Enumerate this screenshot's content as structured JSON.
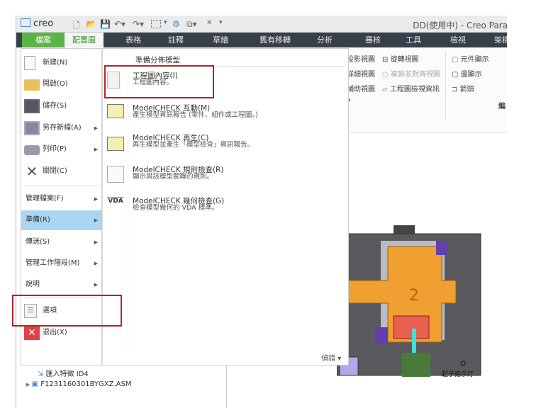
{
  "titlebar": {
    "app_logo": "creo",
    "title": "DD(使用中) - Creo Para"
  },
  "tabs": [
    {
      "label": "檔案"
    },
    {
      "label": "配置圖"
    },
    {
      "label": "表格"
    },
    {
      "label": "註釋"
    },
    {
      "label": "草繪"
    },
    {
      "label": "舊有移轉"
    },
    {
      "label": "分析"
    },
    {
      "label": "審核"
    },
    {
      "label": "工具"
    },
    {
      "label": "檢視"
    },
    {
      "label": "架構"
    }
  ],
  "ribbon": {
    "col1": [
      "投影視圖",
      "詳細視圖",
      "輔助視圖"
    ],
    "col2": [
      "旋轉視圖",
      "複製並對齊視圖",
      "工程圖檢視資訊"
    ],
    "col3": [
      "元件顯示",
      "邊顯示",
      "箭頭"
    ],
    "group_label": "編"
  },
  "file_menu": {
    "items": [
      {
        "label": "新建(N)",
        "icon": "new-file-icon"
      },
      {
        "label": "開啟(O)",
        "icon": "open-folder-icon"
      },
      {
        "label": "儲存(S)",
        "icon": "save-icon"
      },
      {
        "label": "另存新檔(A)",
        "icon": "save-as-icon",
        "submenu": true
      },
      {
        "label": "列印(P)",
        "icon": "print-icon",
        "submenu": true
      },
      {
        "label": "關閉(C)",
        "icon": "close-icon"
      }
    ],
    "sub_items": [
      {
        "label": "管理檔案(F)"
      },
      {
        "label": "準備(R)",
        "selected": true
      },
      {
        "label": "傳送(S)"
      },
      {
        "label": "管理工作階段(M)"
      },
      {
        "label": "說明"
      }
    ],
    "options": "選項",
    "exit": "退出(X)"
  },
  "prepare_menu": {
    "header": "準備分佈模型",
    "items": [
      {
        "title": "工程圖內容(I)",
        "desc": "工程圖內容。"
      },
      {
        "title": "ModelCHECK 互動(M)",
        "desc": "產生模型資訊報告 (零件、組件或工程圖。)"
      },
      {
        "title": "ModelCHECK 再生(C)",
        "desc": "再生模型並產生「模型檢查」資訊報告。"
      },
      {
        "title": "ModelCHECK 規則檢查(R)",
        "desc": "顯示與該模型關聯的規則。"
      },
      {
        "title": "ModelCHECK 幾何檢查(G)",
        "desc": "檢查模型幾何的 VDA 標準。",
        "icon_text": "VDA"
      }
    ],
    "footer": "偵錯"
  },
  "model_tree": {
    "items": [
      "匯入特徵 ID4",
      "F1231160301BYGXZ.ASM"
    ]
  },
  "drawing": {
    "number": "2",
    "label": "起子指示灯"
  },
  "colors": {
    "file_tab": "#5bb446",
    "tabbar": "#37404a",
    "highlight": "#a9d7f3",
    "red_box": "#b0262b",
    "orange": "#f0a030"
  }
}
